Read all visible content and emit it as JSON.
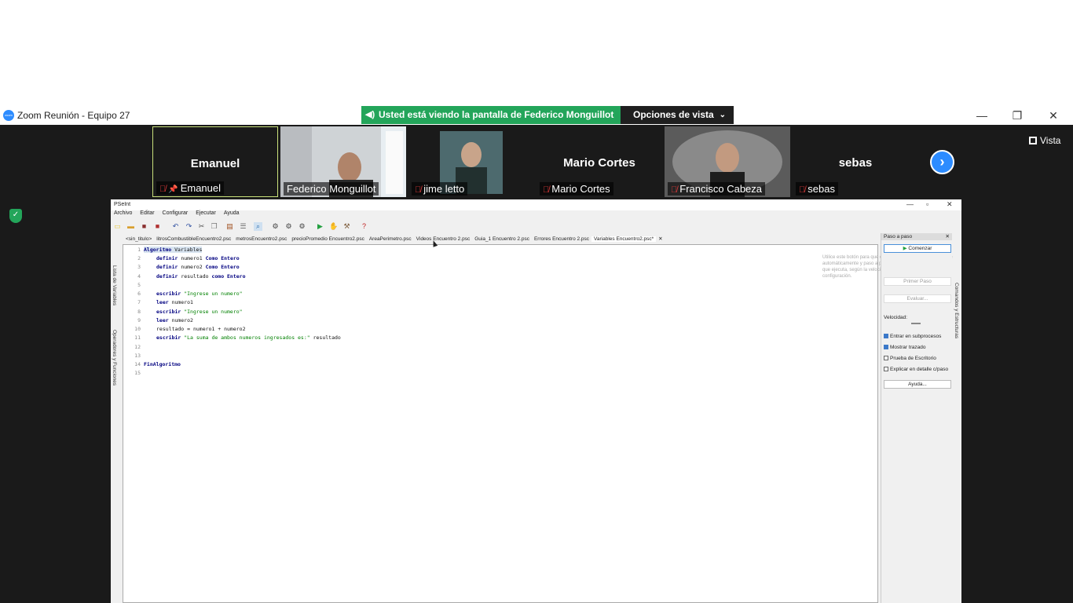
{
  "window": {
    "title": "Zoom Reunión - Equipo 27",
    "logo_text": "zoom"
  },
  "share_banner": {
    "text": "Usted está viendo la pantalla de Federico Monguillot",
    "view_options": "Opciones de vista"
  },
  "window_controls": {
    "minimize": "—",
    "restore": "❐",
    "close": "✕"
  },
  "gallery": {
    "participants": [
      {
        "display_name": "Emanuel",
        "label": "Emanuel",
        "muted": true,
        "pinned": true,
        "video": false
      },
      {
        "display_name": "",
        "label": "Federico Monguillot",
        "muted": false,
        "pinned": false,
        "video": true
      },
      {
        "display_name": "",
        "label": "jime letto",
        "muted": true,
        "pinned": false,
        "video": true
      },
      {
        "display_name": "Mario Cortes",
        "label": "Mario Cortes",
        "muted": true,
        "pinned": false,
        "video": false
      },
      {
        "display_name": "",
        "label": "Francisco Cabeza",
        "muted": true,
        "pinned": false,
        "video": true
      },
      {
        "display_name": "sebas",
        "label": "sebas",
        "muted": true,
        "pinned": false,
        "video": false
      }
    ],
    "next_icon": "›",
    "view_label": "Vista"
  },
  "pseint": {
    "title": "PSeInt",
    "menu": [
      "Archivo",
      "Editar",
      "Configurar",
      "Ejecutar",
      "Ayuda"
    ],
    "tabs": [
      "<sin_titulo>",
      "litrosCombustibleEncuentro2.psc",
      "metrosEncuentro2.psc",
      "precioPromedio Encuentro2.psc",
      "AreaPerimetro.psc",
      "Videos Encuentro 2.psc",
      "Guia_1 Encuentro 2.psc",
      "Errores Encuentro 2.psc",
      "Variables Encuentro2.psc*"
    ],
    "tab_close": "✕",
    "left_side_labels": [
      "Lista de Variables",
      "Operadores y Funciones"
    ],
    "right_side_label": "Comandos y Estructuras",
    "line_numbers": [
      "1",
      "2",
      "3",
      "4",
      "5",
      "6",
      "7",
      "8",
      "9",
      "10",
      "11",
      "12",
      "13",
      "14",
      "15"
    ],
    "code": {
      "l1_kw": "Algoritmo",
      "l1_rest": " Variables",
      "l2_kw": "definir",
      "l2_mid": " numero1 ",
      "l2_kw2": "Como Entero",
      "l3_kw": "definir",
      "l3_mid": " numero2 ",
      "l3_kw2": "Como Entero",
      "l4_kw": "definir",
      "l4_mid": " resultado ",
      "l4_kw2": "como Entero",
      "l6_kw": "escribir",
      "l6_str": " \"Ingrese un numero\"",
      "l7_kw": "leer",
      "l7_rest": " numero1",
      "l8_kw": "escribir",
      "l8_str": " \"Ingrese un numero\"",
      "l9_kw": "leer",
      "l9_rest": " numero2",
      "l10": "resultado = numero1 + numero2",
      "l11_kw": "escribir",
      "l11_str": " \"La suma de ambos numeros ingresados es:\"",
      "l11_rest": " resultado",
      "l14_kw": "FinAlgoritmo"
    },
    "panel": {
      "header": "Paso a paso",
      "start": "Comenzar",
      "first_step": "Primer Paso",
      "evaluate": "Evaluar...",
      "speed_label": "Velocidad:",
      "options": [
        {
          "label": "Entrar en subprocesos",
          "checked": true
        },
        {
          "label": "Mostrar trazado",
          "checked": true
        },
        {
          "label": "Prueba de Escritorio",
          "checked": false
        },
        {
          "label": "Explicar en detalle c/paso",
          "checked": false
        }
      ],
      "help": "Ayuda...",
      "tooltip": "Utilice este botón para que el algoritmo comience a ejecutarse automáticamente y paso a paso, señalando cada instrucción que ejecuta, según la velocidad definida en el menú configuración."
    }
  },
  "colors": {
    "accent_green": "#23a55a",
    "zoom_blue": "#2d8cff",
    "gallery_bg": "#1a1a1a",
    "mute_red": "#e03b3b"
  }
}
